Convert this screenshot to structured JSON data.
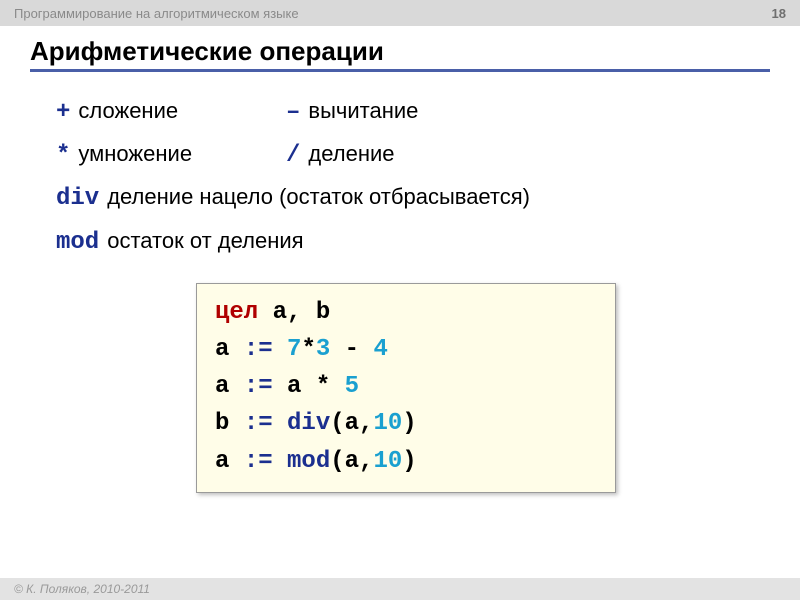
{
  "header": {
    "course": "Программирование на алгоритмическом языке",
    "page": "18"
  },
  "title": "Арифметические операции",
  "ops": {
    "add_sym": "+",
    "add_label": "сложение",
    "sub_sym": "–",
    "sub_label": "вычитание",
    "mul_sym": "*",
    "mul_label": "умножение",
    "div_sym": "/",
    "div_label": "деление",
    "idiv_sym": "div",
    "idiv_label": "деление нацело (остаток отбрасывается)",
    "mod_sym": "mod",
    "mod_label": "остаток от деления"
  },
  "code": {
    "l1_kw": "цел",
    "l1_rest": " a, b",
    "l2_a": "a ",
    "l2_assign": ":=",
    "l2_sp": " ",
    "l2_n1": "7",
    "l2_mul": "*",
    "l2_n2": "3",
    "l2_minus": " - ",
    "l2_n3": "4",
    "l3_a": "a ",
    "l3_assign": ":=",
    "l3_rest": " a ",
    "l3_mul": "*",
    "l3_sp": " ",
    "l3_n": "5",
    "l4_a": "b ",
    "l4_assign": ":=",
    "l4_sp": " ",
    "l4_fn": "div",
    "l4_open": "(a,",
    "l4_n": "10",
    "l4_close": ")",
    "l5_a": "a ",
    "l5_assign": ":=",
    "l5_sp": " ",
    "l5_fn": "mod",
    "l5_open": "(a,",
    "l5_n": "10",
    "l5_close": ")"
  },
  "footer": {
    "copyright": "© К. Поляков, 2010-2011"
  }
}
